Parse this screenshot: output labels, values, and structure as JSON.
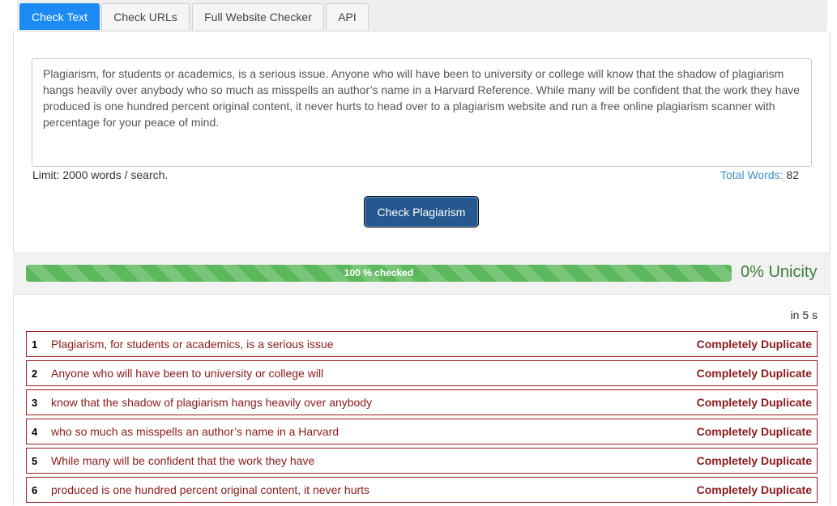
{
  "tabs": [
    {
      "label": "Check Text",
      "active": true
    },
    {
      "label": "Check URLs",
      "active": false
    },
    {
      "label": "Full Website Checker",
      "active": false
    },
    {
      "label": "API",
      "active": false
    }
  ],
  "input": {
    "value": "Plagiarism, for students or academics, is a serious issue. Anyone who will have been to university or college will know that the shadow of plagiarism hangs heavily over anybody who so much as misspells an author’s name in a Harvard Reference. While many will be confident that the work they have produced is one hundred percent original content, it never hurts to head over to a plagiarism website and run a free online plagiarism scanner with percentage for your peace of mind."
  },
  "limit_text": "Limit: 2000 words / search.",
  "total_words": {
    "label": "Total Words:",
    "count": "82"
  },
  "check_button": "Check Plagiarism",
  "progress": {
    "percent": 100,
    "label": "100 % checked"
  },
  "unicity": "0% Unicity",
  "elapsed": "in 5 s",
  "results": [
    {
      "num": "1",
      "text": "Plagiarism, for students or academics, is a serious issue",
      "status": "Completely Duplicate"
    },
    {
      "num": "2",
      "text": "Anyone who will have been to university or college will",
      "status": "Completely Duplicate"
    },
    {
      "num": "3",
      "text": "know that the shadow of plagiarism hangs heavily over anybody",
      "status": "Completely Duplicate"
    },
    {
      "num": "4",
      "text": "who so much as misspells an author’s name in a Harvard",
      "status": "Completely Duplicate"
    },
    {
      "num": "5",
      "text": "While many will be confident that the work they have",
      "status": "Completely Duplicate"
    },
    {
      "num": "6",
      "text": "produced is one hundred percent original content, it never hurts",
      "status": "Completely Duplicate"
    }
  ],
  "colors": {
    "active_tab": "#1b8af3",
    "button": "#24588f",
    "progress": "#5cb85c",
    "duplicate": "#8b1a1a",
    "unicity": "#3c7d3c"
  }
}
